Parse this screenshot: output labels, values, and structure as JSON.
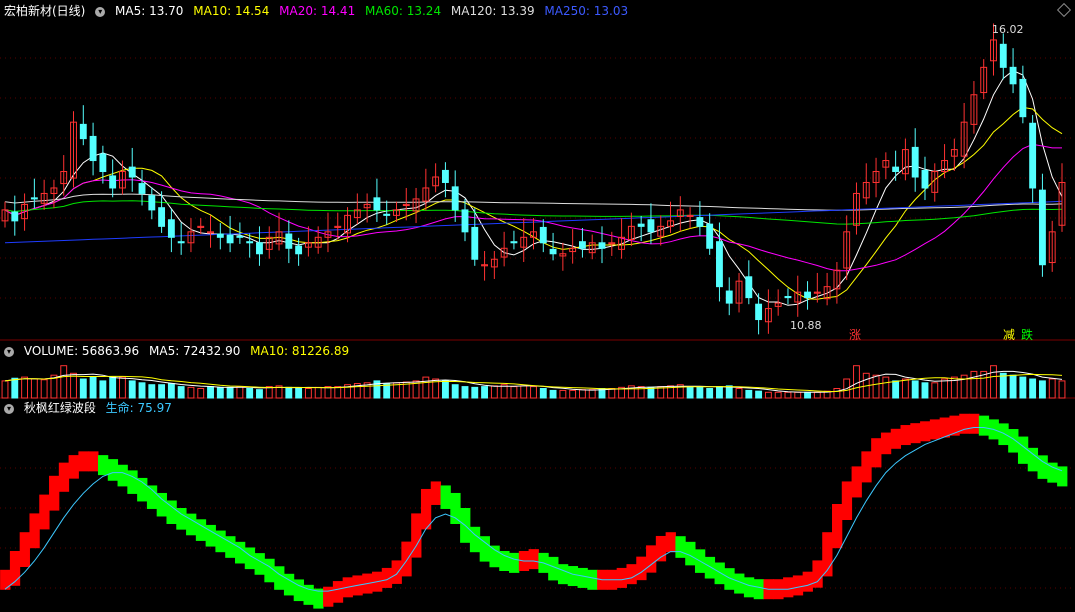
{
  "main_legend": {
    "title": "宏柏新材(日线)",
    "ma5": "MA5: 13.70",
    "ma10": "MA10: 14.54",
    "ma20": "MA20: 14.41",
    "ma60": "MA60: 13.24",
    "ma120": "MA120: 13.39",
    "ma250": "MA250: 13.03"
  },
  "volume_legend": {
    "title": "VOLUME: 56863.96",
    "ma5": "MA5: 72432.90",
    "ma10": "MA10: 81226.89"
  },
  "indicator_legend": {
    "title": "秋枫红绿波段",
    "life": "生命: 75.97"
  },
  "annotations": {
    "high": "16.02",
    "low": "10.88",
    "zhang": "涨",
    "jian": "减",
    "die": "跌"
  },
  "colors": {
    "up": "#ff3232",
    "down": "#54ffff",
    "ma5": "#ffffff",
    "ma10": "#ffff00",
    "ma20": "#ff00ff",
    "ma60": "#00e600",
    "ma120": "#dddddd",
    "ma250": "#1e3cff",
    "red_band": "#ff0000",
    "green_band": "#00ff00",
    "life": "#3cc8ff"
  },
  "chart_data": [
    {
      "type": "candlestick",
      "ylim": [
        10.6,
        16.4
      ],
      "closes": [
        12.9,
        12.7,
        13.0,
        13.1,
        13.2,
        13.3,
        13.6,
        14.5,
        14.2,
        13.8,
        13.6,
        13.3,
        13.6,
        13.5,
        13.2,
        12.9,
        12.6,
        12.4,
        12.3,
        12.5,
        12.6,
        12.5,
        12.4,
        12.3,
        12.4,
        12.3,
        12.1,
        12.4,
        12.5,
        12.2,
        12.1,
        12.3,
        12.4,
        12.5,
        12.6,
        12.8,
        12.9,
        13.0,
        12.9,
        12.8,
        12.9,
        13.0,
        13.1,
        13.3,
        13.5,
        13.4,
        12.9,
        12.5,
        12.0,
        11.9,
        12.0,
        12.2,
        12.3,
        12.4,
        12.5,
        12.3,
        12.1,
        12.1,
        12.2,
        12.2,
        12.3,
        12.2,
        12.3,
        12.4,
        12.6,
        12.6,
        12.5,
        12.6,
        12.7,
        12.9,
        12.8,
        12.6,
        12.2,
        11.5,
        11.2,
        11.6,
        11.3,
        10.9,
        11.1,
        11.2,
        11.3,
        11.4,
        11.3,
        11.4,
        11.5,
        11.8,
        12.5,
        13.2,
        13.4,
        13.6,
        13.8,
        13.6,
        14.0,
        13.5,
        13.3,
        13.6,
        13.8,
        14.0,
        14.5,
        15.0,
        15.5,
        16.0,
        15.5,
        15.2,
        14.6,
        13.3,
        11.9,
        12.5,
        13.4
      ]
    },
    {
      "type": "bar",
      "title": "VOLUME",
      "values": [
        0.45,
        0.52,
        0.55,
        0.5,
        0.48,
        0.6,
        0.85,
        0.65,
        0.5,
        0.55,
        0.45,
        0.55,
        0.55,
        0.45,
        0.4,
        0.35,
        0.35,
        0.38,
        0.3,
        0.28,
        0.25,
        0.3,
        0.28,
        0.28,
        0.3,
        0.25,
        0.22,
        0.3,
        0.32,
        0.28,
        0.25,
        0.25,
        0.28,
        0.3,
        0.3,
        0.35,
        0.38,
        0.4,
        0.45,
        0.38,
        0.4,
        0.42,
        0.45,
        0.55,
        0.5,
        0.45,
        0.35,
        0.3,
        0.28,
        0.3,
        0.32,
        0.35,
        0.3,
        0.32,
        0.3,
        0.25,
        0.2,
        0.2,
        0.2,
        0.22,
        0.22,
        0.25,
        0.25,
        0.28,
        0.32,
        0.3,
        0.28,
        0.3,
        0.32,
        0.35,
        0.3,
        0.28,
        0.25,
        0.3,
        0.32,
        0.25,
        0.2,
        0.18,
        0.15,
        0.15,
        0.15,
        0.15,
        0.15,
        0.15,
        0.18,
        0.25,
        0.5,
        0.85,
        0.65,
        0.6,
        0.55,
        0.45,
        0.5,
        0.45,
        0.4,
        0.4,
        0.5,
        0.55,
        0.6,
        0.7,
        0.7,
        0.85,
        0.65,
        0.6,
        0.55,
        0.5,
        0.45,
        0.5,
        0.45
      ]
    },
    {
      "type": "band",
      "title": "秋枫红绿波段",
      "band": [
        0.15,
        0.25,
        0.35,
        0.45,
        0.55,
        0.65,
        0.72,
        0.76,
        0.78,
        0.78,
        0.76,
        0.73,
        0.7,
        0.66,
        0.62,
        0.58,
        0.54,
        0.5,
        0.47,
        0.44,
        0.41,
        0.38,
        0.35,
        0.32,
        0.29,
        0.26,
        0.23,
        0.19,
        0.15,
        0.12,
        0.09,
        0.07,
        0.05,
        0.06,
        0.09,
        0.11,
        0.12,
        0.13,
        0.14,
        0.16,
        0.2,
        0.3,
        0.45,
        0.58,
        0.62,
        0.58,
        0.5,
        0.4,
        0.35,
        0.3,
        0.27,
        0.25,
        0.24,
        0.25,
        0.26,
        0.24,
        0.2,
        0.18,
        0.17,
        0.16,
        0.15,
        0.15,
        0.15,
        0.16,
        0.18,
        0.22,
        0.28,
        0.33,
        0.35,
        0.32,
        0.28,
        0.24,
        0.21,
        0.18,
        0.15,
        0.13,
        0.11,
        0.1,
        0.1,
        0.1,
        0.11,
        0.12,
        0.14,
        0.2,
        0.35,
        0.5,
        0.62,
        0.7,
        0.78,
        0.85,
        0.88,
        0.9,
        0.92,
        0.93,
        0.94,
        0.95,
        0.96,
        0.97,
        0.98,
        0.98,
        0.97,
        0.95,
        0.92,
        0.88,
        0.82,
        0.78,
        0.74,
        0.72,
        0.7
      ],
      "life": [
        0.1,
        0.14,
        0.19,
        0.25,
        0.32,
        0.4,
        0.48,
        0.55,
        0.61,
        0.66,
        0.7,
        0.72,
        0.72,
        0.7,
        0.67,
        0.63,
        0.58,
        0.54,
        0.5,
        0.47,
        0.44,
        0.41,
        0.38,
        0.35,
        0.32,
        0.28,
        0.25,
        0.22,
        0.18,
        0.15,
        0.12,
        0.1,
        0.09,
        0.09,
        0.1,
        0.11,
        0.12,
        0.13,
        0.14,
        0.15,
        0.18,
        0.25,
        0.33,
        0.42,
        0.48,
        0.5,
        0.48,
        0.44,
        0.39,
        0.35,
        0.31,
        0.28,
        0.26,
        0.25,
        0.25,
        0.24,
        0.22,
        0.2,
        0.18,
        0.17,
        0.16,
        0.15,
        0.15,
        0.15,
        0.16,
        0.19,
        0.23,
        0.27,
        0.3,
        0.3,
        0.28,
        0.25,
        0.22,
        0.19,
        0.16,
        0.14,
        0.12,
        0.11,
        0.1,
        0.1,
        0.1,
        0.11,
        0.12,
        0.14,
        0.2,
        0.28,
        0.38,
        0.48,
        0.57,
        0.65,
        0.72,
        0.77,
        0.81,
        0.84,
        0.87,
        0.89,
        0.91,
        0.93,
        0.95,
        0.96,
        0.96,
        0.95,
        0.93,
        0.9,
        0.86,
        0.82,
        0.78,
        0.75,
        0.73
      ]
    }
  ]
}
